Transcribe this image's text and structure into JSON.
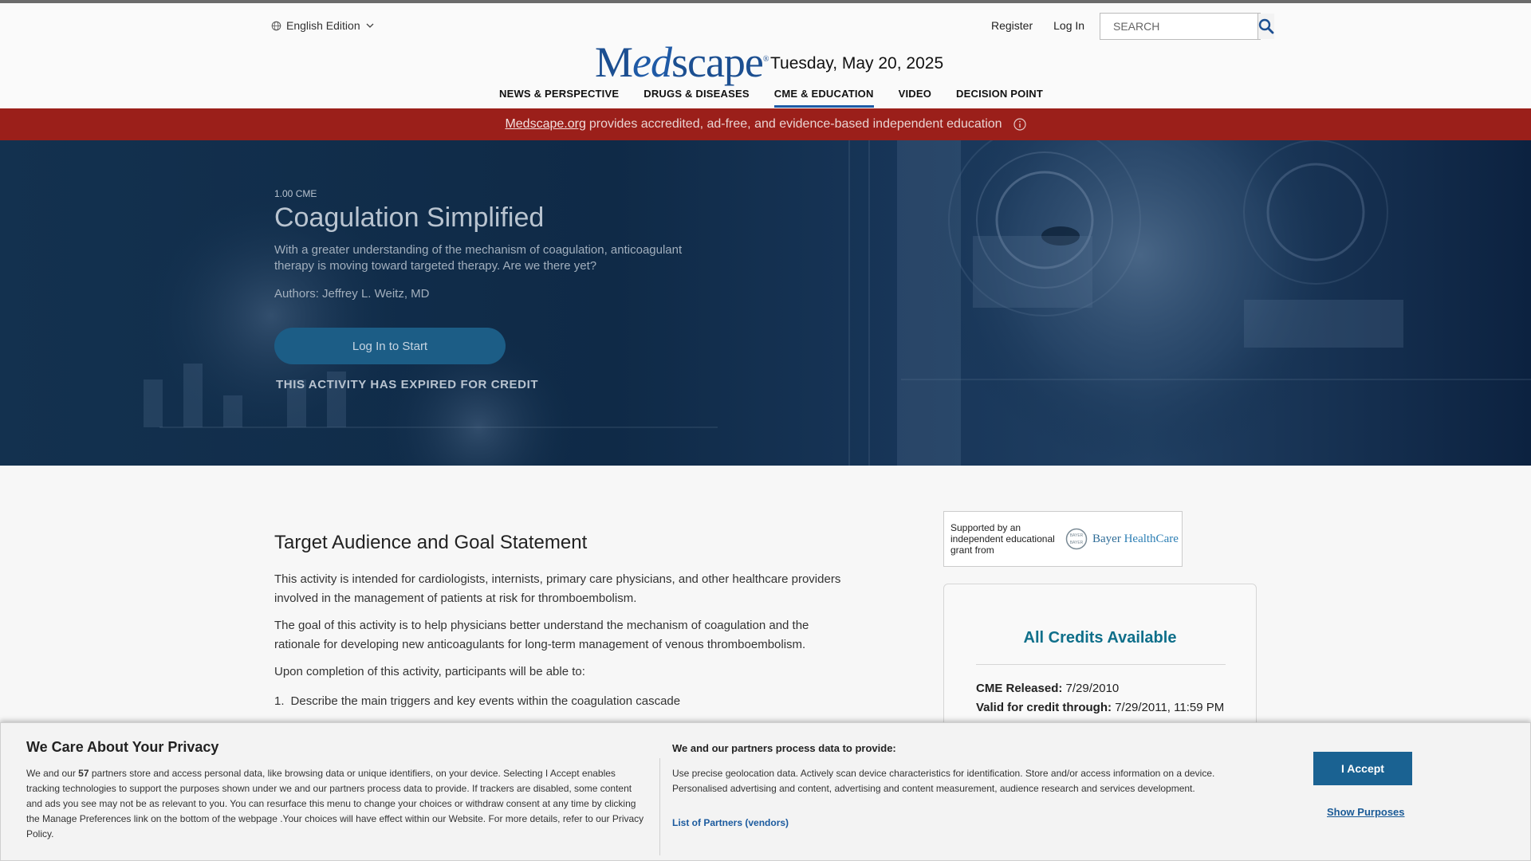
{
  "header": {
    "edition": "English Edition",
    "register": "Register",
    "login": "Log In",
    "search_placeholder": "SEARCH",
    "logo": {
      "part1": "M",
      "part2": "ed",
      "part3": "scape",
      "mark": "®"
    },
    "date": "Tuesday, May 20, 2025",
    "nav": [
      {
        "label": "NEWS & PERSPECTIVE",
        "active": false
      },
      {
        "label": "DRUGS & DISEASES",
        "active": false
      },
      {
        "label": "CME & EDUCATION",
        "active": true
      },
      {
        "label": "VIDEO",
        "active": false
      },
      {
        "label": "DECISION POINT",
        "active": false
      }
    ]
  },
  "banner": {
    "link": "Medscape.org",
    "text": "provides accredited, ad-free, and evidence-based independent education"
  },
  "hero": {
    "credit": "1.00 CME",
    "title": "Coagulation Simplified",
    "description": "With a greater understanding of the mechanism of coagulation, anticoagulant therapy is moving toward targeted therapy. Are we there yet?",
    "authors": "Authors: Jeffrey L. Weitz, MD",
    "start_button": "Log In to Start",
    "expired": "THIS ACTIVITY HAS EXPIRED FOR CREDIT"
  },
  "content": {
    "section_title": "Target Audience and Goal Statement",
    "paragraphs": [
      "This activity is intended for cardiologists, internists, primary care physicians, and other healthcare providers involved in the management of patients at risk for thromboembolism.",
      "The goal of this activity is to help physicians better understand the mechanism of coagulation and the rationale for developing new anticoagulants for long-term management of venous thromboembolism.",
      "Upon completion of this activity, participants will be able to:"
    ],
    "objectives": [
      {
        "num": "1.",
        "text": "Describe the main triggers and key events within the coagulation cascade"
      }
    ]
  },
  "support": {
    "text": "Supported by an independent educational grant from",
    "sponsor_a": "Bayer",
    "sponsor_b": "HealthCare",
    "seal_text": "BAYER"
  },
  "credits": {
    "title": "All Credits Available",
    "released_label": "CME Released:",
    "released_value": "7/29/2010",
    "valid_label": "Valid for credit through:",
    "valid_value": "7/29/2011, 11:59 PM"
  },
  "privacy": {
    "title": "We Care About Your Privacy",
    "body_pre": "We and our",
    "partners_count": "57",
    "body_post": "partners store and access personal data, like browsing data or unique identifiers, on your device. Selecting I Accept enables tracking technologies to support the purposes shown under we and our partners process data to provide. If trackers are disabled, some content and ads you see may not be as relevant to you. You can resurface this menu to change your choices or withdraw consent at any time by clicking the Manage Preferences link on the bottom of the webpage .Your choices will have effect within our Website. For more details, refer to our Privacy Policy.",
    "right_title": "We and our partners process data to provide:",
    "right_body": "Use precise geolocation data. Actively scan device characteristics for identification. Store and/or access information on a device. Personalised advertising and content, advertising and content measurement, audience research and services development.",
    "partners_link": "List of Partners (vendors)",
    "accept": "I Accept",
    "show_purposes": "Show Purposes"
  },
  "colors": {
    "brand_blue": "#1c4f91",
    "banner_red": "#9b1f1a",
    "accept_blue": "#1a6292",
    "credits_teal": "#0f6f8a"
  }
}
